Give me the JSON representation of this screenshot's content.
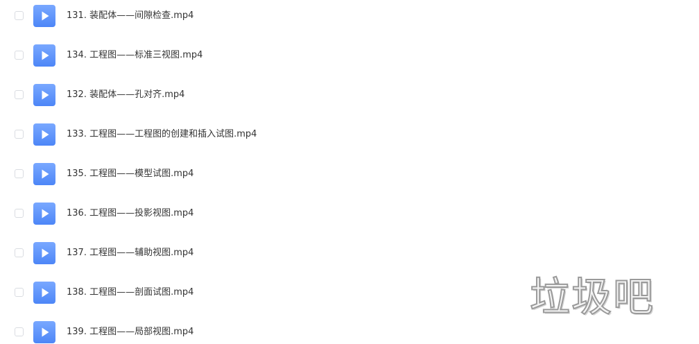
{
  "files": [
    {
      "name": "131. 装配体——间隙检查.mp4",
      "icon": "video-play-icon"
    },
    {
      "name": "134. 工程图——标准三视图.mp4",
      "icon": "video-play-icon"
    },
    {
      "name": "132. 装配体——孔对齐.mp4",
      "icon": "video-play-icon"
    },
    {
      "name": "133. 工程图——工程图的创建和插入试图.mp4",
      "icon": "video-play-icon"
    },
    {
      "name": "135. 工程图——模型试图.mp4",
      "icon": "video-play-icon"
    },
    {
      "name": "136. 工程图——投影视图.mp4",
      "icon": "video-play-icon"
    },
    {
      "name": "137. 工程图——辅助视图.mp4",
      "icon": "video-play-icon"
    },
    {
      "name": "138. 工程图——剖面试图.mp4",
      "icon": "video-play-icon"
    },
    {
      "name": "139. 工程图——局部视图.mp4",
      "icon": "video-play-icon"
    }
  ],
  "watermark": {
    "text": "垃圾吧"
  },
  "colors": {
    "icon_accent": "#5b92fa",
    "text": "#333333",
    "checkbox_border": "#d9dce1"
  }
}
